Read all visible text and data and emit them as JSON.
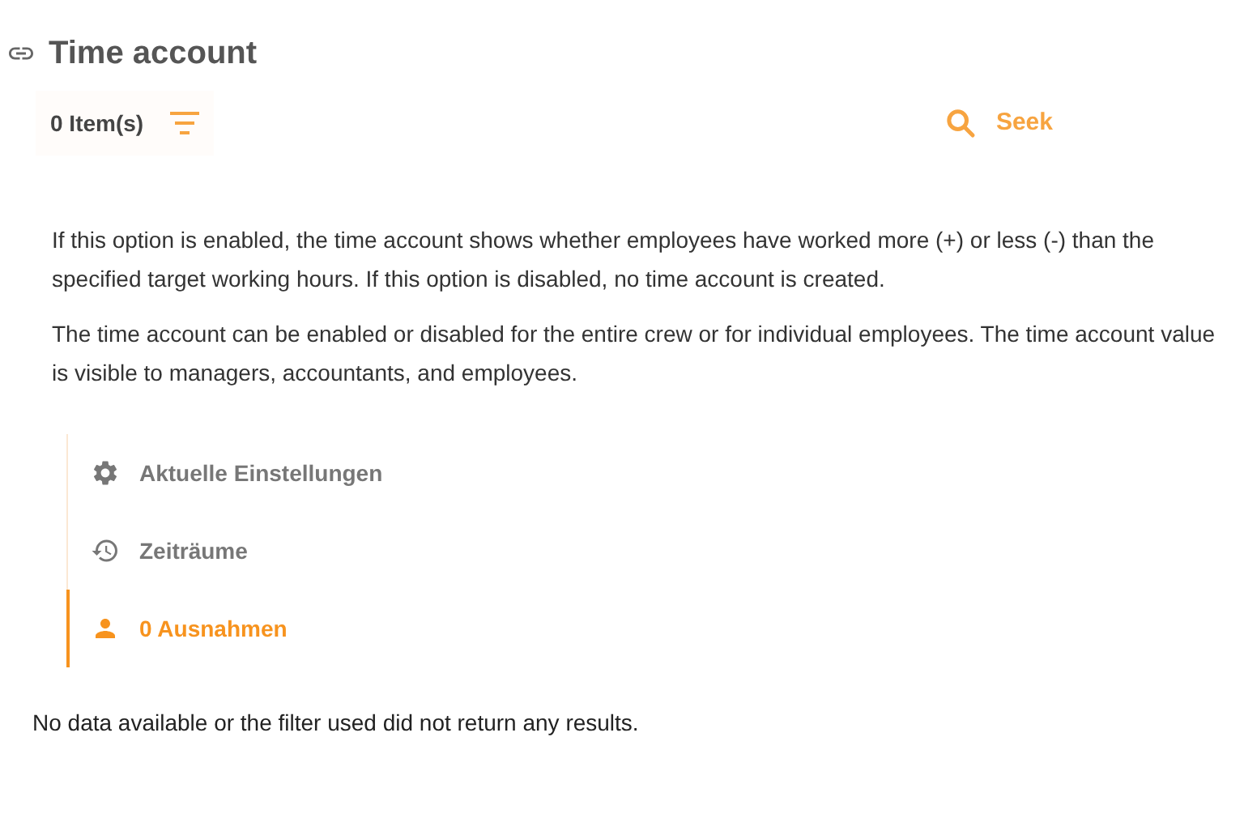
{
  "title": "Time account",
  "toolbar": {
    "count": "0 Item(s)",
    "search_button": "Seek"
  },
  "paragraphs": [
    "If this option is enabled, the time account shows whether employees have worked more (+) or less (-) than the specified target working hours. If this option is disabled, no time account is created.",
    "The time account can be enabled or disabled for the entire crew or for individual employees. The time account value is visible to managers, accountants, and employees."
  ],
  "tabs": [
    {
      "kind": "settings",
      "label": "Aktuelle Einstellungen",
      "selected": false
    },
    {
      "kind": "history",
      "label": "Zeiträume",
      "selected": false
    },
    {
      "kind": "person",
      "label": "0 Ausnahmen",
      "selected": true
    }
  ],
  "empty_message": "No data available or the filter used did not return any results."
}
